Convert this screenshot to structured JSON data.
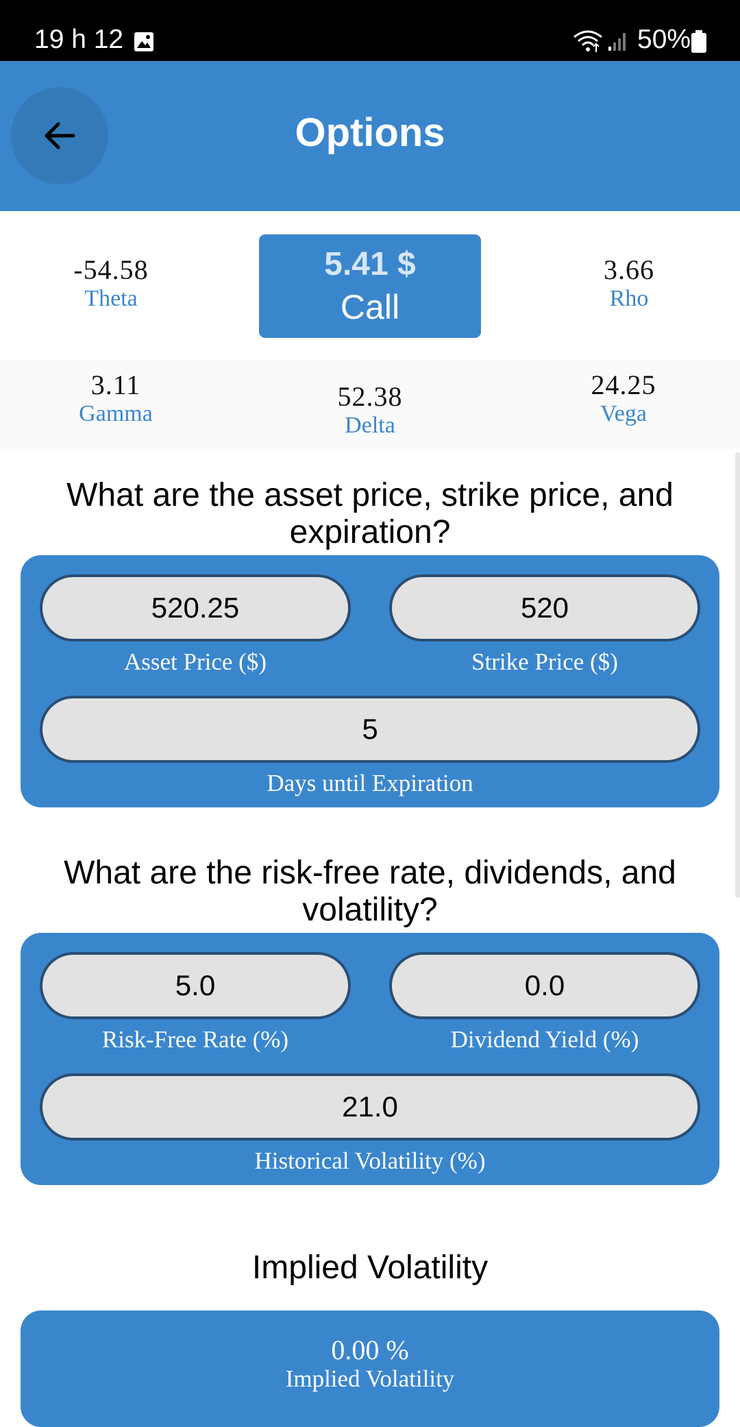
{
  "status_bar": {
    "time": "19 h 12",
    "battery": "50%",
    "icons": [
      "gallery-icon",
      "wifi-icon",
      "signal-icon",
      "battery-icon"
    ]
  },
  "app_bar": {
    "title": "Options",
    "back_icon": "arrow-left-icon"
  },
  "result": {
    "price": "5.41 $",
    "type": "Call"
  },
  "greeks": {
    "theta": {
      "value": "-54.58",
      "label": "Theta"
    },
    "rho": {
      "value": "3.66",
      "label": "Rho"
    },
    "gamma": {
      "value": "3.11",
      "label": "Gamma"
    },
    "delta": {
      "value": "52.38",
      "label": "Delta"
    },
    "vega": {
      "value": "24.25",
      "label": "Vega"
    }
  },
  "section1": {
    "heading_line1": "What are the asset price, strike price, and",
    "heading_line2": "expiration?",
    "asset_price": {
      "value": "520.25",
      "label": "Asset Price ($)"
    },
    "strike_price": {
      "value": "520",
      "label": "Strike Price ($)"
    },
    "days": {
      "value": "5",
      "label": "Days until Expiration"
    }
  },
  "section2": {
    "heading_line1": "What are the risk-free rate, dividends, and",
    "heading_line2": "volatility?",
    "risk_free": {
      "value": "5.0",
      "label": "Risk-Free Rate (%)"
    },
    "dividend": {
      "value": "0.0",
      "label": "Dividend Yield (%)"
    },
    "volatility": {
      "value": "21.0",
      "label": "Historical Volatility (%)"
    }
  },
  "section3": {
    "heading": "Implied Volatility",
    "value": "0.00 %",
    "label": "Implied Volatility"
  },
  "colors": {
    "primary": "#3a86cd",
    "pill_bg": "#e2e2e2",
    "pill_border": "#2a4e73"
  }
}
